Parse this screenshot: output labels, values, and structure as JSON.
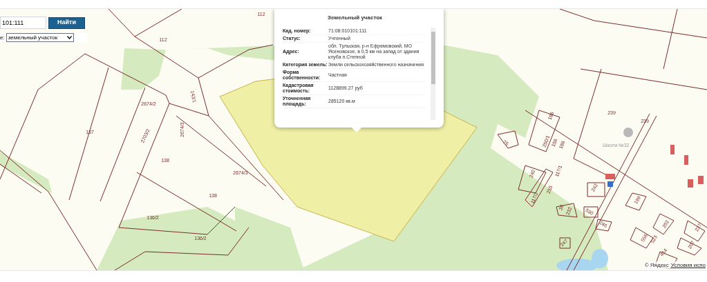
{
  "search": {
    "value": "101:111",
    "button": "Найти",
    "type_label": "е:",
    "type_value": "земельный участок"
  },
  "popup": {
    "title": "Земельный участок",
    "rows": [
      {
        "label": "Кад. номер:",
        "value": "71:08:010101:111"
      },
      {
        "label": "Статус:",
        "value": "Учтенный"
      },
      {
        "label": "Адрес:",
        "value": "обл. Тульская, р-н Ефремовский, МО Ясеновское, в 0,5 км на запад от здания клуба п.Степной"
      },
      {
        "label": "Категория земель:",
        "value": "Земли сельскохозяйственного назначения"
      },
      {
        "label": "Форма собственности:",
        "value": "Частная"
      },
      {
        "label": "Кадастровая стоимость:",
        "value": "1128899.27 руб"
      },
      {
        "label": "Уточненная площадь:",
        "value": "285120 кв.м"
      }
    ]
  },
  "map_labels": [
    "112",
    "112",
    "143/1",
    "2674/2",
    "137",
    "2703/2",
    "2674/3",
    "138",
    "2674/3",
    "138",
    "136/2",
    "136/2",
    "76",
    "239",
    "239",
    "186",
    "250/1",
    "156",
    "186",
    "240",
    "117/1",
    "117/2",
    "255",
    "242",
    "38",
    "232",
    "530",
    "246",
    "247",
    "199",
    "202",
    "556",
    "523",
    "237",
    "207",
    "414"
  ],
  "poi": {
    "name": "Школа №32"
  },
  "attribution": {
    "copyright": "© Яндекс",
    "terms": "Условия испо"
  }
}
